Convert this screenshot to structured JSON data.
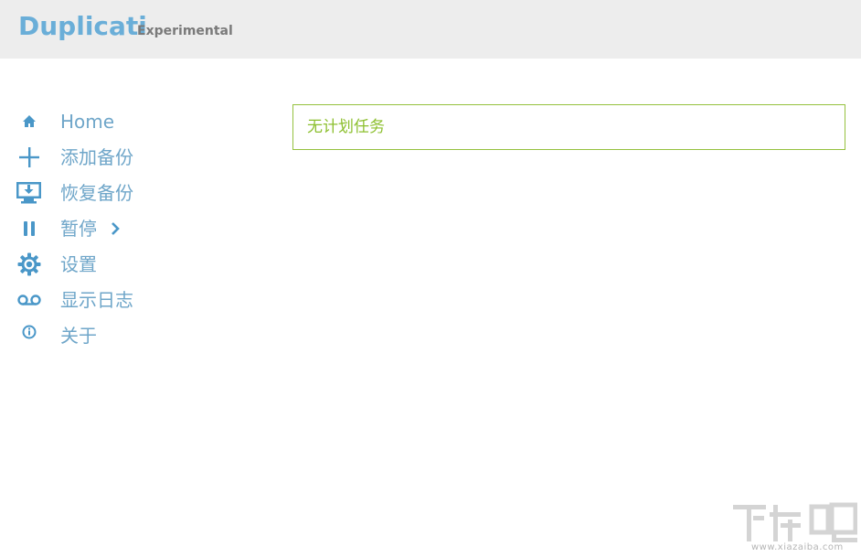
{
  "header": {
    "brand": "Duplicati",
    "subtitle": "Experimental",
    "background": "#ededed",
    "brand_color": "#6aaed8"
  },
  "nav": {
    "items": [
      {
        "label": "Home",
        "icon": "home-icon"
      },
      {
        "label": "添加备份",
        "icon": "plus-icon"
      },
      {
        "label": "恢复备份",
        "icon": "monitor-download-icon"
      },
      {
        "label": "暂停",
        "icon": "pause-icon",
        "has_submenu": true
      },
      {
        "label": "设置",
        "icon": "gear-icon"
      },
      {
        "label": "显示日志",
        "icon": "voicemail-icon"
      },
      {
        "label": "关于",
        "icon": "info-icon"
      }
    ],
    "color": "#6fa6c9"
  },
  "main": {
    "status_text": "无计划任务",
    "border_color": "#95c13e",
    "text_color": "#8cbf2e"
  },
  "watermark": {
    "text": "下载吧",
    "url_text": "www.xiazaiba.com"
  }
}
